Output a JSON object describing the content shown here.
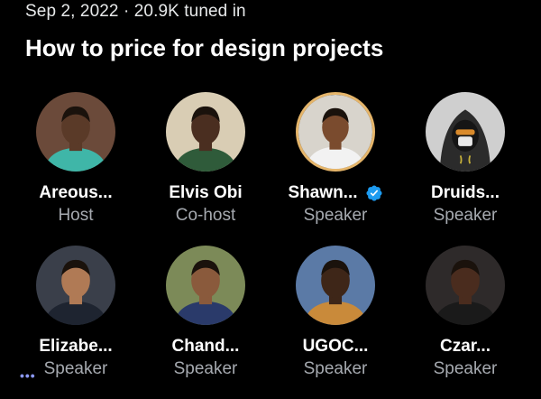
{
  "space": {
    "meta": "Sep 2, 2022 · 20.9K tuned in",
    "title": "How to price for design projects"
  },
  "participants": [
    {
      "name": "Areous...",
      "role": "Host",
      "avatar": "avatar-photo",
      "bg": "#6b4a3a",
      "skin": "#5a3a28",
      "shirt": "#3fb6a8"
    },
    {
      "name": "Elvis Obi",
      "role": "Co-host",
      "avatar": "avatar-photo",
      "bg": "#d9cdb4",
      "skin": "#4a2e20",
      "shirt": "#2f5b3a"
    },
    {
      "name": "Shawn...",
      "role": "Speaker",
      "avatar": "avatar-photo",
      "verified": true,
      "speaking": true,
      "bg": "#d8d4cc",
      "skin": "#7a4b2e",
      "shirt": "#f2f2f2"
    },
    {
      "name": "Druids...",
      "role": "Speaker",
      "avatar": "hooded-figure",
      "bg": "#cfcfcf",
      "skin": "#222222",
      "shirt": "#2a2a2a"
    },
    {
      "name": "Elizabe...",
      "role": "Speaker",
      "avatar": "avatar-photo",
      "typing": true,
      "bg": "#3a3f4a",
      "skin": "#b07a55",
      "shirt": "#1e2430"
    },
    {
      "name": "Chand...",
      "role": "Speaker",
      "avatar": "avatar-photo",
      "bg": "#7c8a58",
      "skin": "#8a5a3c",
      "shirt": "#2a3a6a"
    },
    {
      "name": "UGOC...",
      "role": "Speaker",
      "avatar": "avatar-photo",
      "bg": "#5b7aa6",
      "skin": "#3e2618",
      "shirt": "#c98a3a"
    },
    {
      "name": "Czar...",
      "role": "Speaker",
      "avatar": "avatar-photo",
      "bg": "#2e2a2a",
      "skin": "#4a2c1e",
      "shirt": "#1a1a1a"
    }
  ],
  "colors": {
    "background": "#000000",
    "text_primary": "#ffffff",
    "text_secondary": "#a6aab0",
    "verified": "#1d9bf0",
    "speaking_ring": "#e5b56a",
    "typing_dots": "#8b98f4"
  },
  "icons": {
    "verified": "verified-badge-icon",
    "typing": "ellipsis-icon"
  }
}
